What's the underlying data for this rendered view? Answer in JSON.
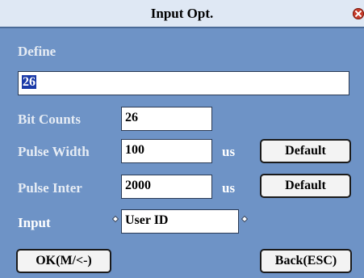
{
  "window": {
    "title": "Input Opt."
  },
  "form": {
    "define_label": "Define",
    "define_value": "26",
    "bit_counts_label": "Bit Counts",
    "bit_counts_value": "26",
    "pulse_width_label": "Pulse Width",
    "pulse_width_value": "100",
    "pulse_width_unit": "us",
    "pulse_inter_label": "Pulse Inter",
    "pulse_inter_value": "2000",
    "pulse_inter_unit": "us",
    "input_label": "Input",
    "input_value": "User ID"
  },
  "buttons": {
    "default_label": "Default",
    "ok_label": "OK(M/<-)",
    "back_label": "Back(ESC)"
  },
  "icons": {
    "close": "close-icon",
    "left_arrow": "left-arrow-icon",
    "right_arrow": "right-arrow-icon"
  },
  "colors": {
    "panel": "#6e93c6",
    "titlebar": "#dfe8f4",
    "selection": "#1a3aa8"
  }
}
